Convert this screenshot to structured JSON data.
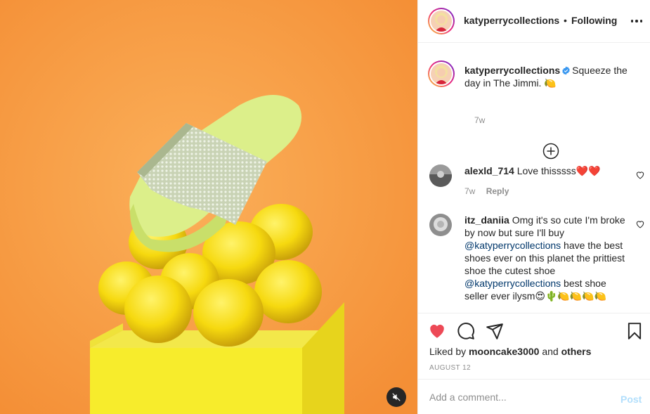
{
  "post": {
    "username": "katyperrycollections",
    "dot": "•",
    "follow_status": "Following",
    "caption": "Squeeze the day in The Jimmi. 🍋",
    "caption_time": "7w",
    "verified": true
  },
  "comments": [
    {
      "username": "alexld_714",
      "text": "Love thisssss❤️❤️",
      "time": "7w",
      "reply_label": "Reply"
    },
    {
      "username": "itz_daniia",
      "text_part1": "Omg it's so cute I'm broke by now but sure I'll buy ",
      "mention1": "@katyperrycollections",
      "text_part2": " have the best shoes ever on this planet the prittiest shoe the cutest shoe ",
      "mention2": "@katyperrycollections",
      "text_part3": " best shoe seller ever ilysm😍🌵🍋🍋🍋🍋"
    }
  ],
  "likes": {
    "prefix": "Liked by ",
    "user": "mooncake3000",
    "middle": " and ",
    "others": "others"
  },
  "date": "AUGUST 12",
  "add_comment": {
    "placeholder": "Add a comment...",
    "post_label": "Post"
  },
  "colors": {
    "background_orange": "#f79a3e",
    "like_red": "#ed4956",
    "verified_blue": "#3897f0",
    "post_disabled": "#b2dffc",
    "mention_blue": "#00376b"
  },
  "icons": {
    "mute": "speaker-muted-icon",
    "like": "heart-filled-icon",
    "comment": "speech-bubble-icon",
    "share": "paper-plane-icon",
    "save": "bookmark-icon",
    "more": "more-dots-icon",
    "load_more": "plus-circle-icon"
  }
}
